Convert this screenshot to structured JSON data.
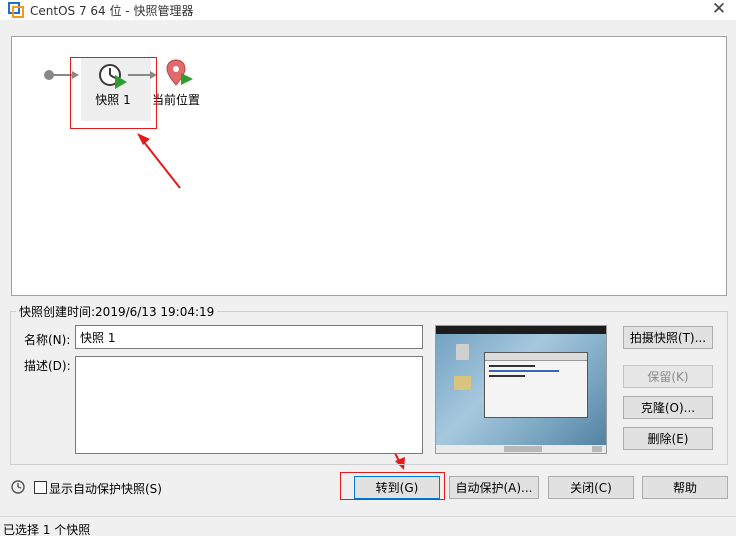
{
  "window": {
    "title": "CentOS 7 64 位 - 快照管理器",
    "close_glyph": "✕"
  },
  "tree": {
    "snapshot_label": "快照 1",
    "current_label": "当前位置"
  },
  "details": {
    "group_caption": "快照创建时间:2019/6/13 19:04:19",
    "name_label": "名称(N):",
    "name_value": "快照 1",
    "desc_label": "描述(D):",
    "desc_value": ""
  },
  "side_buttons": {
    "take_snapshot": "拍摄快照(T)...",
    "keep": "保留(K)",
    "clone": "克隆(O)...",
    "delete": "删除(E)"
  },
  "bottom": {
    "show_autoprotect": "显示自动保护快照(S)",
    "goto": "转到(G)",
    "autoprotect": "自动保护(A)...",
    "close": "关闭(C)",
    "help": "帮助"
  },
  "status": {
    "text": "已选择 1 个快照"
  },
  "colors": {
    "annotation_red": "#e11a1a",
    "play_green": "#2e9e2e",
    "pin_red": "#e36a6a"
  },
  "icons": {
    "app": "vmware-icon",
    "snapshot": "clock-play-icon",
    "current": "location-pin-play-icon",
    "history": "history-icon"
  }
}
